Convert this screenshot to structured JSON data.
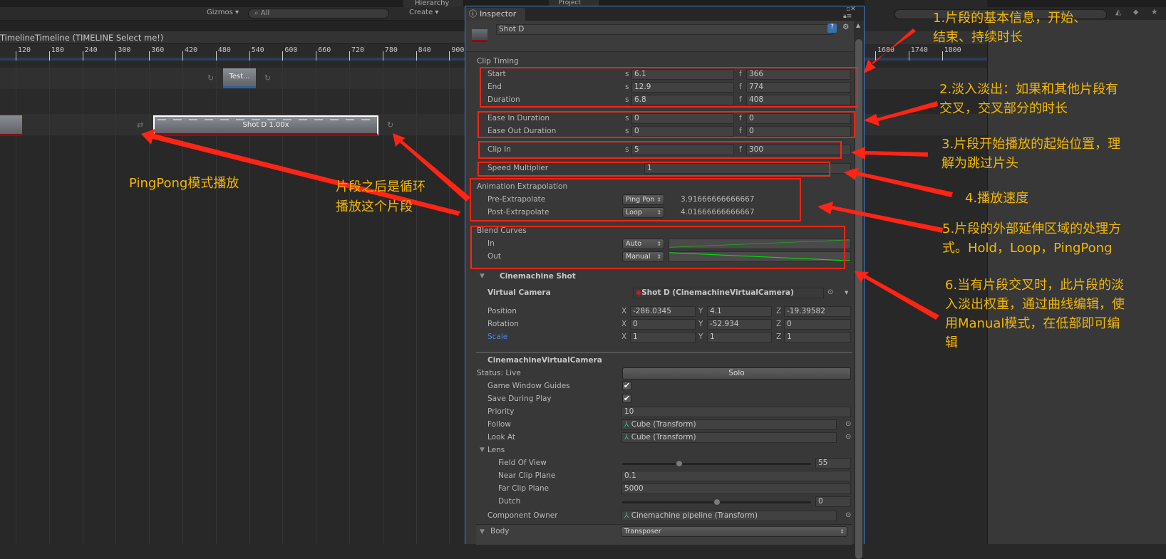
{
  "toolbar": {
    "gizmos": "Gizmos ▾",
    "scene_search": "All",
    "hierarchy_tab": "Hierarchy",
    "project_tab": "Project",
    "create": "Create ▾"
  },
  "timeline": {
    "breadcrumb": "TimelineTimeline (TIMELINE Select me!)",
    "ruler_ticks": [
      "120",
      "180",
      "240",
      "300",
      "360",
      "420",
      "480",
      "540",
      "600",
      "660",
      "720",
      "780",
      "840",
      "900"
    ],
    "ruler_ticks_right": [
      "1680",
      "1740",
      "1800"
    ],
    "clips": {
      "test": "Test...",
      "shot_d": "Shot D 1.00x"
    }
  },
  "inspector": {
    "tab": "Inspector",
    "object_name": "Shot D",
    "clip_timing": {
      "title": "Clip Timing",
      "rows": [
        {
          "label": "Start",
          "s": "6.1",
          "f": "366"
        },
        {
          "label": "End",
          "s": "12.9",
          "f": "774"
        },
        {
          "label": "Duration",
          "s": "6.8",
          "f": "408"
        },
        {
          "label": "Ease In Duration",
          "s": "0",
          "f": "0"
        },
        {
          "label": "Ease Out Duration",
          "s": "0",
          "f": "0"
        },
        {
          "label": "Clip In",
          "s": "5",
          "f": "300"
        }
      ],
      "s_unit": "s",
      "f_unit": "f"
    },
    "speed": {
      "label": "Speed Multiplier",
      "value": "1"
    },
    "extrapolation": {
      "title": "Animation Extrapolation",
      "pre": {
        "label": "Pre-Extrapolate",
        "mode": "Ping Pon",
        "value": "3.91666666666667"
      },
      "post": {
        "label": "Post-Extrapolate",
        "mode": "Loop",
        "value": "4.01666666666667"
      }
    },
    "blend_curves": {
      "title": "Blend Curves",
      "in": {
        "label": "In",
        "mode": "Auto"
      },
      "out": {
        "label": "Out",
        "mode": "Manual"
      },
      "curve_color": "#00e000"
    },
    "cinemachine_shot": {
      "title": "Cinemachine Shot",
      "virtual_camera": {
        "label": "Virtual Camera",
        "value": "Shot D (CinemachineVirtualCamera)"
      },
      "position": {
        "label": "Position",
        "x": "-286.0345",
        "y": "4.1",
        "z": "-19.39582"
      },
      "rotation": {
        "label": "Rotation",
        "x": "0",
        "y": "-52.934",
        "z": "0"
      },
      "scale": {
        "label": "Scale",
        "x": "1",
        "y": "1",
        "z": "1"
      },
      "axis": {
        "x": "X",
        "y": "Y",
        "z": "Z"
      }
    },
    "vcam": {
      "title": "CinemachineVirtualCamera",
      "status": "Status: Live",
      "solo": "Solo",
      "game_window_guides": {
        "label": "Game Window Guides",
        "checked": true
      },
      "save_during_play": {
        "label": "Save During Play",
        "checked": true
      },
      "priority": {
        "label": "Priority",
        "value": "10"
      },
      "follow": {
        "label": "Follow",
        "value": "Cube (Transform)"
      },
      "look_at": {
        "label": "Look At",
        "value": "Cube (Transform)"
      },
      "lens": {
        "label": "Lens",
        "fov": {
          "label": "Field Of View",
          "value": "55",
          "min": 1,
          "max": 179
        },
        "near": {
          "label": "Near Clip Plane",
          "value": "0.1"
        },
        "far": {
          "label": "Far Clip Plane",
          "value": "5000"
        },
        "dutch": {
          "label": "Dutch",
          "value": "0",
          "min": -180,
          "max": 180
        }
      },
      "component_owner": {
        "label": "Component Owner",
        "value": "Cinemachine pipeline (Transform)"
      },
      "body": {
        "label": "Body",
        "value": "Transposer"
      }
    }
  },
  "annotations": {
    "n1": [
      "1.片段的基本信息，开始、",
      "结束、持续时长"
    ],
    "n2": [
      "2.淡入淡出：如果和其他片段有",
      "交叉，交叉部分的时长"
    ],
    "n3": [
      "3.片段开始播放的起始位置，理",
      "解为跳过片头"
    ],
    "n4": [
      "4.播放速度"
    ],
    "n5": [
      "5.片段的外部延伸区域的处理方",
      "式。Hold，Loop，PingPong"
    ],
    "n6": [
      "6.当有片段交叉时，此片段的淡",
      "入淡出权重，通过曲线编辑，使",
      "用Manual模式，在低部即可编",
      "辑"
    ],
    "pingpong": [
      "PingPong模式播放"
    ],
    "loop": [
      "片段之后是循环",
      "播放这个片段"
    ],
    "color": "#f2b705",
    "highlight_color": "#ff2414"
  }
}
